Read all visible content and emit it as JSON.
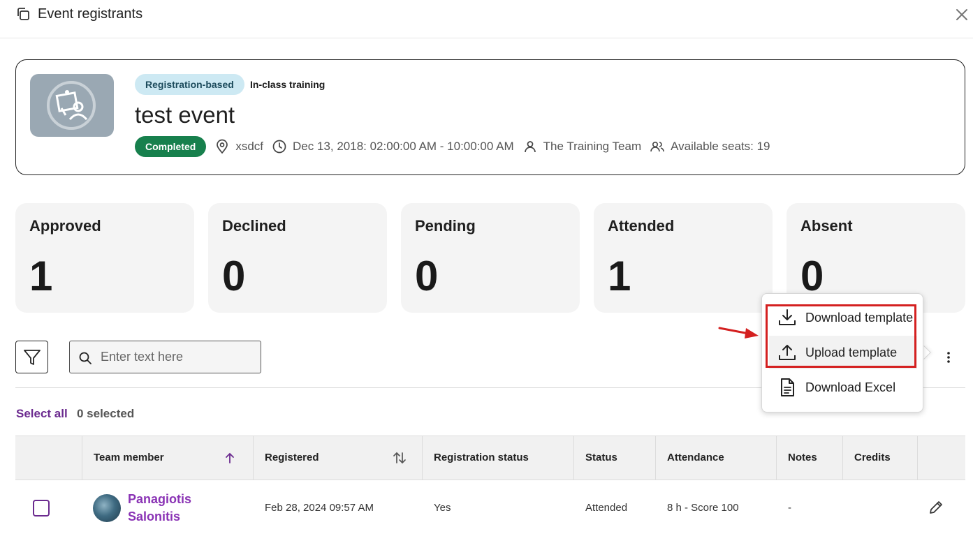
{
  "header": {
    "title": "Event registrants",
    "icon": "copy-icon",
    "close_icon": "close-icon"
  },
  "event": {
    "type_badge": "Registration-based",
    "format": "In-class training",
    "title": "test event",
    "status": "Completed",
    "location": "xsdcf",
    "datetime": "Dec 13, 2018: 02:00:00 AM - 10:00:00 AM",
    "organizer": "The Training Team",
    "seats": "Available seats: 19",
    "colors": {
      "type_badge_bg": "#cde9f3",
      "status_bg": "#17804d"
    }
  },
  "stats": [
    {
      "label": "Approved",
      "value": "1"
    },
    {
      "label": "Declined",
      "value": "0"
    },
    {
      "label": "Pending",
      "value": "0"
    },
    {
      "label": "Attended",
      "value": "1"
    },
    {
      "label": "Absent",
      "value": "0"
    }
  ],
  "toolbar": {
    "search_placeholder": "Enter text here",
    "filter_icon": "filter-icon",
    "more_icon": "kebab-icon"
  },
  "menu": {
    "items": [
      {
        "label": "Download template",
        "icon": "download-icon"
      },
      {
        "label": "Upload template",
        "icon": "upload-icon"
      },
      {
        "label": "Download Excel",
        "icon": "document-icon"
      }
    ]
  },
  "selection": {
    "select_all": "Select all",
    "count": "0 selected"
  },
  "table": {
    "headers": [
      "Team member",
      "Registered",
      "Registration status",
      "Status",
      "Attendance",
      "Notes",
      "Credits"
    ],
    "rows": [
      {
        "member": "Panagiotis Salonitis",
        "registered": "Feb 28, 2024 09:57 AM",
        "registration_status": "Yes",
        "status": "Attended",
        "attendance": "8 h - Score 100",
        "notes": "-",
        "credits": ""
      }
    ]
  },
  "accent_color": "#6b2a8f"
}
